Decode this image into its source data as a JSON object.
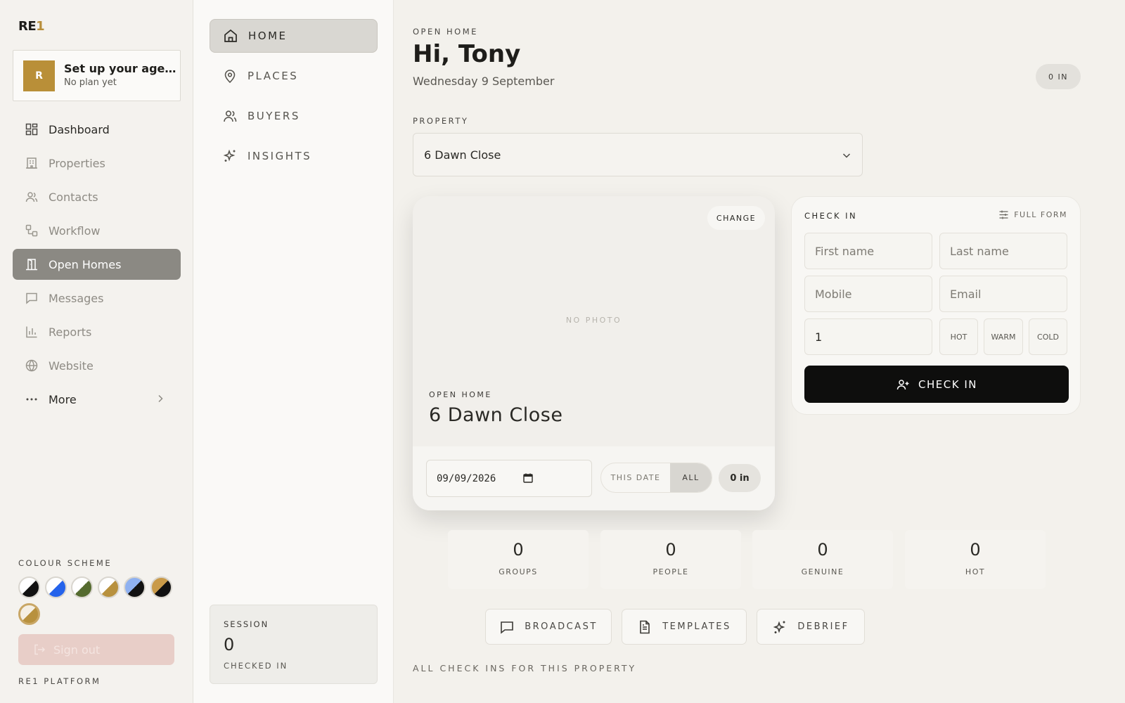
{
  "app": {
    "logo_text": "RE",
    "logo_accent": "1"
  },
  "agency": {
    "avatar_initial": "R",
    "title": "Set up your agen...",
    "subtitle": "No plan yet"
  },
  "sidebar": {
    "items": [
      {
        "label": "Dashboard",
        "icon": "grid-icon"
      },
      {
        "label": "Properties",
        "icon": "building-icon"
      },
      {
        "label": "Contacts",
        "icon": "users-icon"
      },
      {
        "label": "Workflow",
        "icon": "workflow-icon"
      },
      {
        "label": "Open Homes",
        "icon": "door-icon"
      },
      {
        "label": "Messages",
        "icon": "message-icon"
      },
      {
        "label": "Reports",
        "icon": "bar-chart-icon"
      },
      {
        "label": "Website",
        "icon": "globe-icon"
      },
      {
        "label": "More",
        "icon": "ellipsis-icon"
      }
    ],
    "active": "Open Homes",
    "colour_scheme_label": "COLOUR SCHEME",
    "colour_schemes": [
      {
        "a": "#111111",
        "b": "#ffffff"
      },
      {
        "a": "#2563eb",
        "b": "#ffffff"
      },
      {
        "a": "#556b2f",
        "b": "#ffffff"
      },
      {
        "a": "#b8913e",
        "b": "#ffffff"
      },
      {
        "a": "#111111",
        "b": "#8fb1f0"
      },
      {
        "a": "#111111",
        "b": "#c99a48"
      },
      {
        "a": "#b8913e",
        "b": "#f5efe3"
      }
    ],
    "selected_scheme_index": 6,
    "sign_out_label": "Sign out",
    "platform_label": "RE1 PLATFORM"
  },
  "subnav": {
    "items": [
      {
        "label": "HOME",
        "icon": "home-icon"
      },
      {
        "label": "PLACES",
        "icon": "map-pin-icon"
      },
      {
        "label": "BUYERS",
        "icon": "users-icon"
      },
      {
        "label": "INSIGHTS",
        "icon": "sparkles-icon"
      }
    ],
    "active": "HOME",
    "session": {
      "label": "SESSION",
      "value": "0",
      "sub": "CHECKED IN"
    }
  },
  "header": {
    "eyebrow": "OPEN HOME",
    "greeting": "Hi, Tony",
    "date": "Wednesday 9 September",
    "in_badge": "0 IN"
  },
  "property": {
    "label": "PROPERTY",
    "selected": "6 Dawn Close"
  },
  "photo_card": {
    "change_label": "CHANGE",
    "no_photo": "NO PHOTO",
    "eyebrow": "OPEN HOME",
    "address": "6 Dawn Close",
    "date_value": "09/09/2026",
    "filter_this_date": "THIS DATE",
    "filter_all": "ALL",
    "active_filter": "ALL",
    "in_count": "0 in"
  },
  "check_in": {
    "title": "CHECK IN",
    "full_form": "FULL FORM",
    "first_name_placeholder": "First name",
    "last_name_placeholder": "Last name",
    "mobile_placeholder": "Mobile",
    "email_placeholder": "Email",
    "group_size": "1",
    "temps": [
      "HOT",
      "WARM",
      "COLD"
    ],
    "submit": "CHECK IN"
  },
  "stats": [
    {
      "value": "0",
      "label": "GROUPS"
    },
    {
      "value": "0",
      "label": "PEOPLE"
    },
    {
      "value": "0",
      "label": "GENUINE"
    },
    {
      "value": "0",
      "label": "HOT"
    }
  ],
  "actions": [
    {
      "label": "BROADCAST",
      "icon": "message-square-icon"
    },
    {
      "label": "TEMPLATES",
      "icon": "document-icon"
    },
    {
      "label": "DEBRIEF",
      "icon": "sparkles-icon"
    }
  ],
  "all_checkins_label": "ALL CHECK INS FOR THIS PROPERTY",
  "colors": {
    "accent_gold": "#b98f38",
    "active_nav": "#8b8983",
    "primary_button": "#0e0e0d",
    "sign_out_bg": "#e8cec8"
  }
}
